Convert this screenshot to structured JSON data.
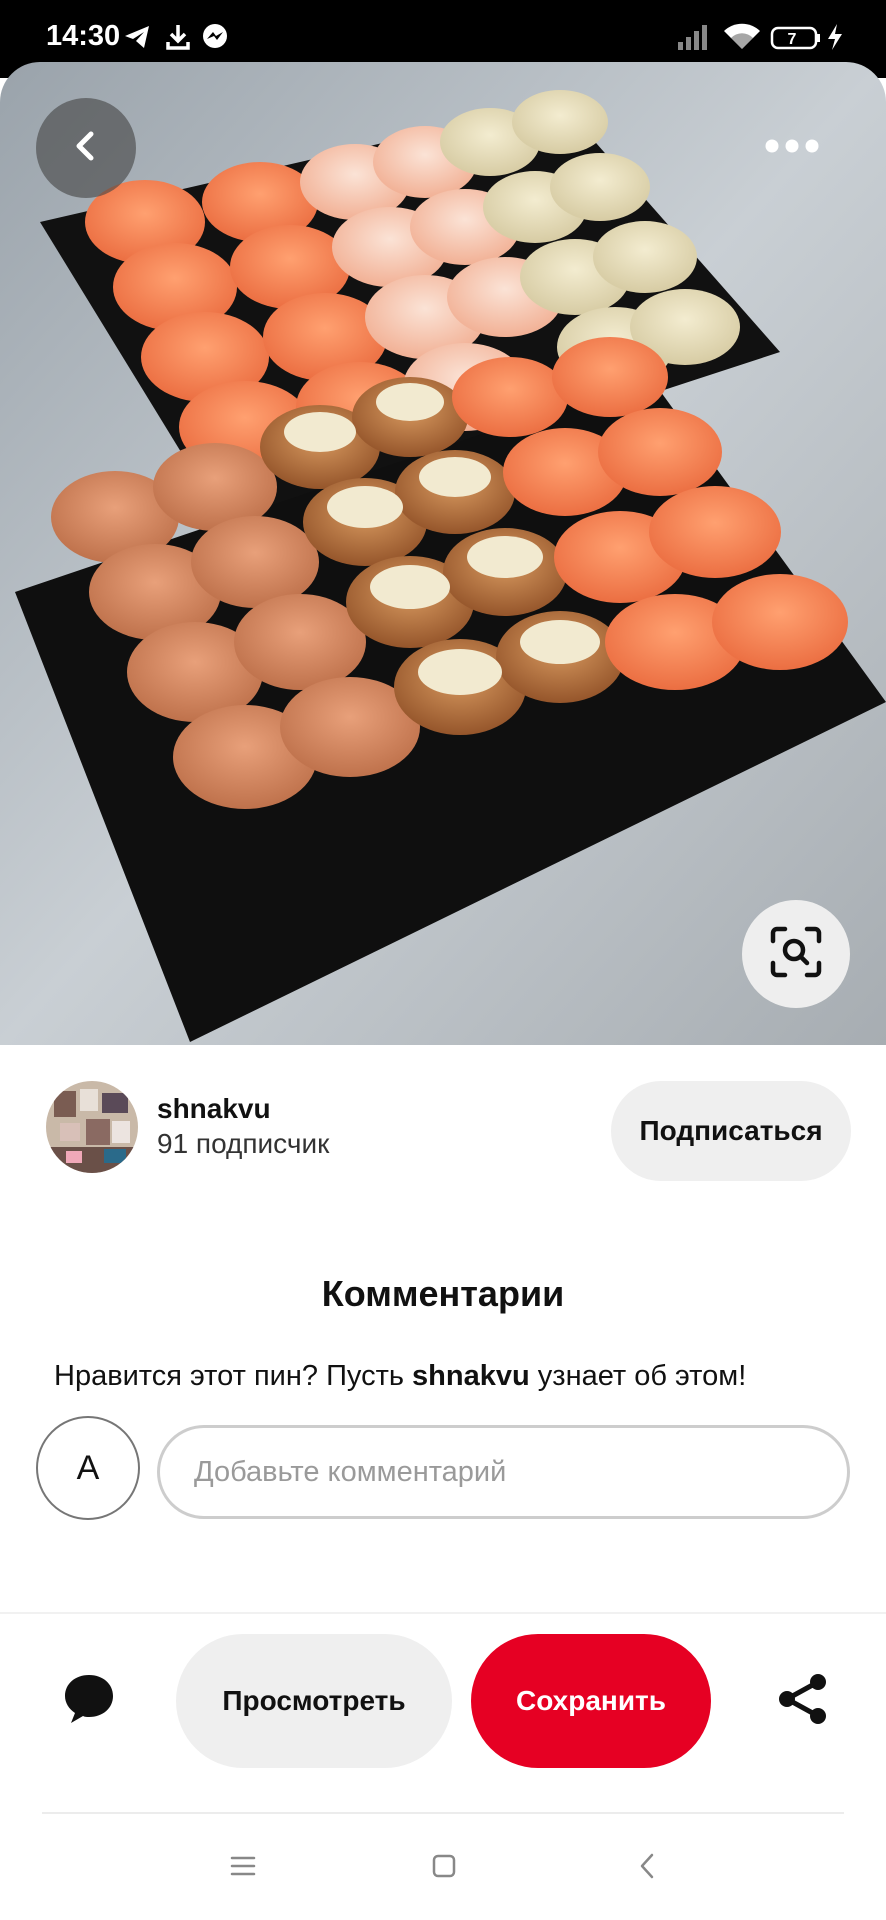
{
  "status_bar": {
    "time": "14:30",
    "battery": "7",
    "icons": [
      "telegram-icon",
      "download-icon",
      "messenger-icon",
      "signal-icon",
      "wifi-icon",
      "battery-icon",
      "charging-bolt-icon"
    ]
  },
  "pin": {
    "image_subject": "sushi-rolls-photo",
    "controls": {
      "back": "back-chevron-icon",
      "more": "more-dots-icon",
      "visual_search": "visual-search-icon"
    }
  },
  "author": {
    "name": "shnakvu",
    "followers": "91 подписчик",
    "follow_label": "Подписаться"
  },
  "comments": {
    "title": "Комментарии",
    "prompt_before": "Нравится этот пин? Пусть ",
    "prompt_user": "shnakvu",
    "prompt_after": " узнает об этом!",
    "user_initial": "А",
    "input_placeholder": "Добавьте комментарий"
  },
  "actions": {
    "view_label": "Просмотреть",
    "save_label": "Сохранить",
    "save_color": "#e60023",
    "icons": [
      "chat-bubble-icon",
      "share-icon"
    ]
  },
  "nav": {
    "icons": [
      "menu-icon",
      "home-square-icon",
      "back-icon"
    ]
  }
}
